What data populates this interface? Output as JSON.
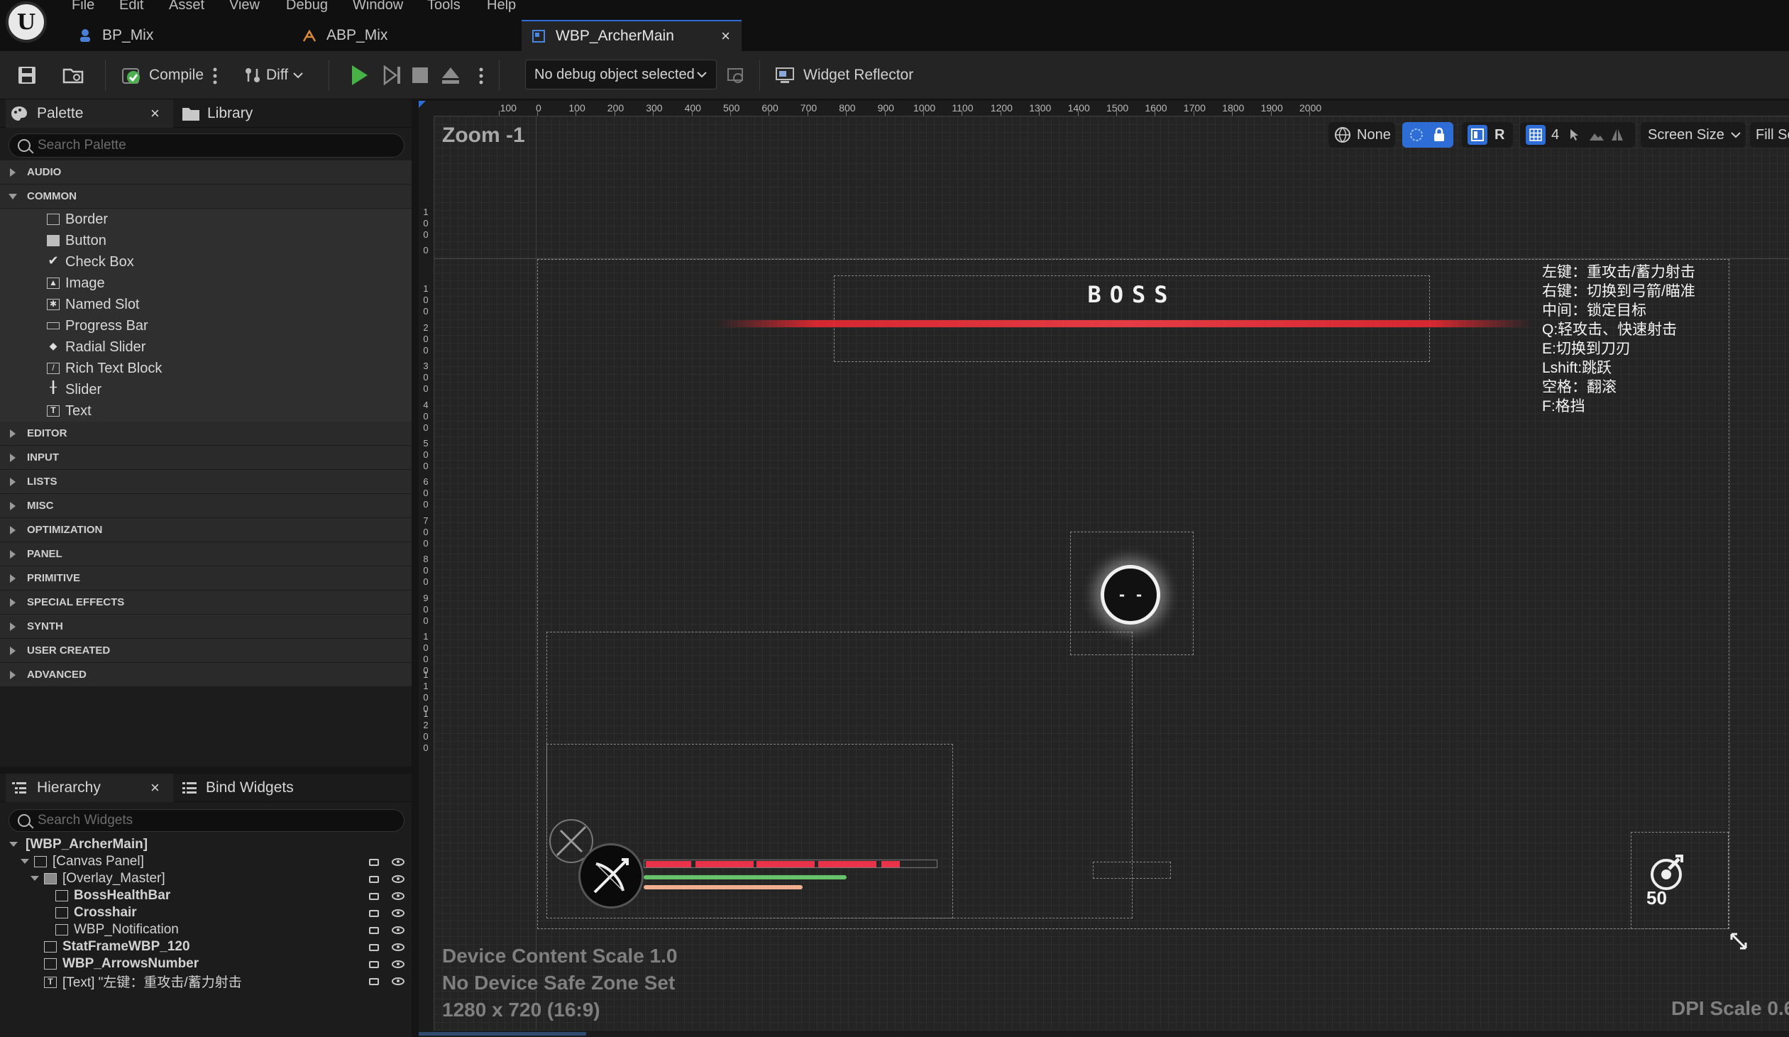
{
  "menu": [
    "File",
    "Edit",
    "Asset",
    "View",
    "Debug",
    "Window",
    "Tools",
    "Help"
  ],
  "tabs": [
    {
      "label": "BP_Mix"
    },
    {
      "label": "ABP_Mix"
    },
    {
      "label": "WBP_ArcherMain",
      "close": "×"
    }
  ],
  "toolbar": {
    "compile": "Compile",
    "diff": "Diff",
    "debug_object": "No debug object selected",
    "widget_reflector": "Widget Reflector"
  },
  "palette": {
    "tab": "Palette",
    "close": "×",
    "library_tab": "Library",
    "search_placeholder": "Search Palette",
    "categories_top": [
      "AUDIO",
      "COMMON"
    ],
    "common_items": [
      "Border",
      "Button",
      "Check Box",
      "Image",
      "Named Slot",
      "Progress Bar",
      "Radial Slider",
      "Rich Text Block",
      "Slider",
      "Text"
    ],
    "categories_bottom": [
      "EDITOR",
      "INPUT",
      "LISTS",
      "MISC",
      "OPTIMIZATION",
      "PANEL",
      "PRIMITIVE",
      "SPECIAL EFFECTS",
      "SYNTH",
      "USER CREATED",
      "ADVANCED"
    ]
  },
  "hierarchy": {
    "tab": "Hierarchy",
    "close": "×",
    "bind_tab": "Bind Widgets",
    "search_placeholder": "Search Widgets",
    "rows": [
      "[WBP_ArcherMain]",
      "[Canvas Panel]",
      "[Overlay_Master]",
      "BossHealthBar",
      "Crosshair",
      "WBP_Notification",
      "StatFrameWBP_120",
      "WBP_ArrowsNumber",
      "[Text] \"左键：重攻击/蓄力射击"
    ]
  },
  "designer": {
    "zoom": "Zoom -1",
    "ruler_x": [
      "100",
      "0",
      "100",
      "200",
      "300",
      "400",
      "500",
      "600",
      "700",
      "800",
      "900",
      "1000",
      "1100",
      "1200",
      "1300",
      "1400",
      "1500",
      "1600",
      "1700",
      "1800",
      "1900",
      "2000"
    ],
    "ruler_y": [
      "100",
      "0",
      "100",
      "200",
      "300",
      "400",
      "500",
      "600",
      "700",
      "800",
      "900",
      "1000",
      "1100",
      "1200"
    ],
    "viewport_buttons": {
      "none": "None",
      "r": "R",
      "grid": "4",
      "screen_size": "Screen Size",
      "fill": "Fill Sc"
    },
    "boss_label": "BOSS",
    "controls_text": [
      "左键：重攻击/蓄力射击",
      "右键：切换到弓箭/瞄准",
      "中间：锁定目标",
      "Q:轻攻击、快速射击",
      "E:切换到刀刃",
      "Lshift:跳跃",
      "空格：翻滚",
      "F:格挡"
    ],
    "crosshair_text": "- -",
    "arrows_count": "50",
    "device_content_scale": "Device Content Scale 1.0",
    "safe_zone": "No Device Safe Zone Set",
    "resolution": "1280 x 720 (16:9)",
    "dpi_scale": "DPI Scale 0.6"
  },
  "colors": {
    "accent": "#2f6dd6",
    "boss_bar": "#e53b44",
    "health_bar": "#e8334a",
    "stamina_bar": "#67c46a",
    "exp_bar": "#f0b090"
  }
}
